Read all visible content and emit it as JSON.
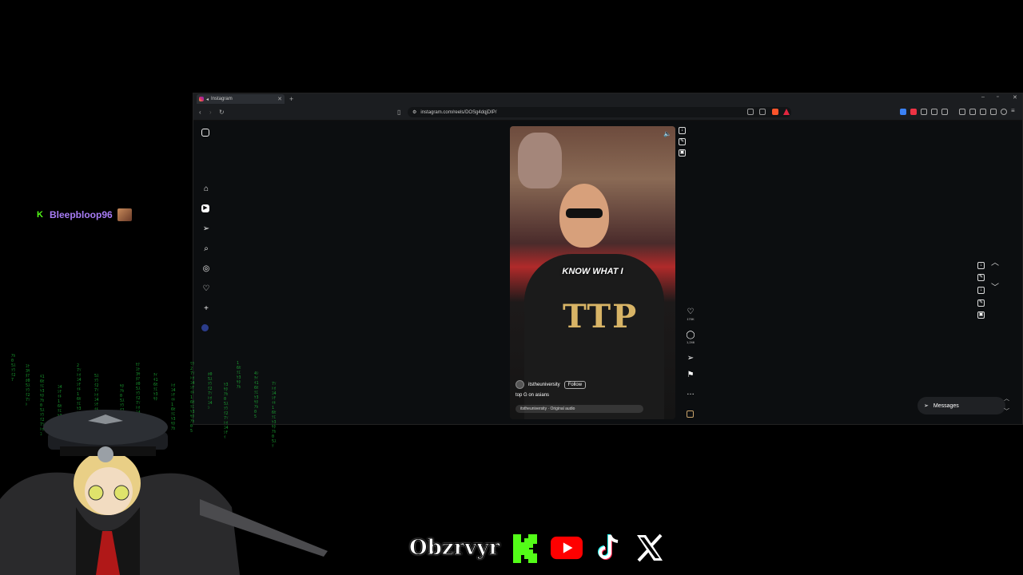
{
  "chat": {
    "username": "Bleepbloop96",
    "platform_badge": "K"
  },
  "browser": {
    "tab_title": "Instagram",
    "new_tab": "+",
    "url": "instagram.com/reels/DOSg4dqjDIP/",
    "window_controls": [
      "–",
      "▫",
      "✕"
    ]
  },
  "instagram": {
    "sidebar_icons": [
      "instagram-logo-icon",
      "home-icon",
      "reels-icon",
      "direct-icon",
      "search-icon",
      "explore-icon",
      "heart-icon",
      "create-icon",
      "profile-icon"
    ],
    "reel": {
      "caption_overlay": "KNOW WHAT I",
      "shirt_logo": "TTP",
      "author": "itstheuniversity",
      "follow_label": "Follow",
      "description": "top G on asians",
      "audio": "itstheuniversity · Original audio",
      "likes": "170K",
      "comments": "1,246"
    },
    "messages_label": "Messages"
  },
  "socials": {
    "handle": "Obzrvyr"
  },
  "colors": {
    "kick_green": "#53fc18",
    "youtube_red": "#ff0000",
    "matrix_green": "#1fbf3a",
    "username_purple": "#a77cf5"
  }
}
